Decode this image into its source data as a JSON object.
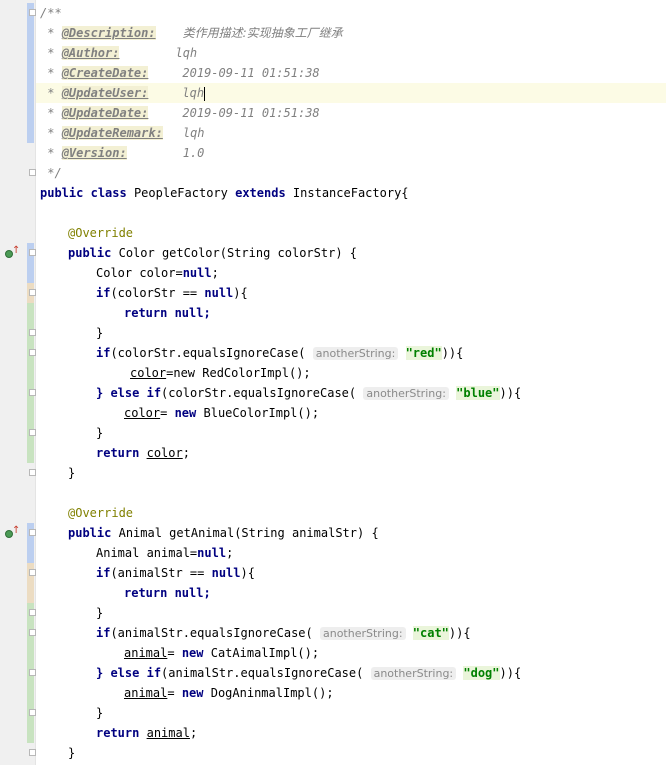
{
  "javadoc": {
    "open": "/**",
    "close": " */",
    "star": " * ",
    "fields": [
      {
        "tag": "@Description:",
        "value": "类作用描述:实现抽象工厂继承"
      },
      {
        "tag": "@Author:",
        "value": "lqh"
      },
      {
        "tag": "@CreateDate:",
        "value": "2019-09-11 01:51:38"
      },
      {
        "tag": "@UpdateUser:",
        "value": "lqh"
      },
      {
        "tag": "@UpdateDate:",
        "value": "2019-09-11 01:51:38"
      },
      {
        "tag": "@UpdateRemark:",
        "value": "lqh"
      },
      {
        "tag": "@Version:",
        "value": "1.0"
      }
    ]
  },
  "class_decl": {
    "kw1": "public",
    "kw2": "class",
    "name": "PeopleFactory",
    "kw3": "extends",
    "parent": "InstanceFactory{"
  },
  "annotation": "@Override",
  "hint_label": "anotherString:",
  "methods": [
    {
      "kw_public": "public",
      "signature": "Color getColor(String colorStr) {",
      "decl_type": "Color color=",
      "null_kw": "null",
      "semi": ";",
      "if_kw": "if",
      "null_check": "(colorStr == ",
      "null_check_end": "){",
      "return_kw": "return",
      "return_null": " null;",
      "close_brace": "}",
      "cond1_pre": "(colorStr.equalsIgnoreCase(",
      "str1": "\"red\"",
      "cond_end": ")){",
      "assign1_var": "color",
      "assign1_rest": "=new RedColorImpl();",
      "else_kw": "} else",
      "cond2_pre": "(colorStr.equalsIgnoreCase(",
      "str2": "\"blue\"",
      "assign2_var": "color",
      "assign2_eq": "= ",
      "new_kw": "new",
      "assign2_rest": " BlueColorImpl();",
      "return_var": "color",
      "method_close": "}"
    },
    {
      "kw_public": "public",
      "signature": "Animal getAnimal(String animalStr) {",
      "decl_type": "Animal animal=",
      "null_kw": "null",
      "semi": ";",
      "if_kw": "if",
      "null_check": "(animalStr == ",
      "null_check_end": "){",
      "return_kw": "return",
      "return_null": " null;",
      "close_brace": "}",
      "cond1_pre": "(animalStr.equalsIgnoreCase(",
      "str1": "\"cat\"",
      "cond_end": ")){",
      "assign1_var": "animal",
      "assign1_eq": "= ",
      "new_kw": "new",
      "assign1_rest": " CatAimalImpl();",
      "else_kw": "} else",
      "cond2_pre": "(animalStr.equalsIgnoreCase(",
      "str2": "\"dog\"",
      "assign2_var": "animal",
      "assign2_eq": "= ",
      "assign2_rest": " DogAninmalImpl();",
      "return_var": "animal",
      "method_close": "}"
    }
  ]
}
